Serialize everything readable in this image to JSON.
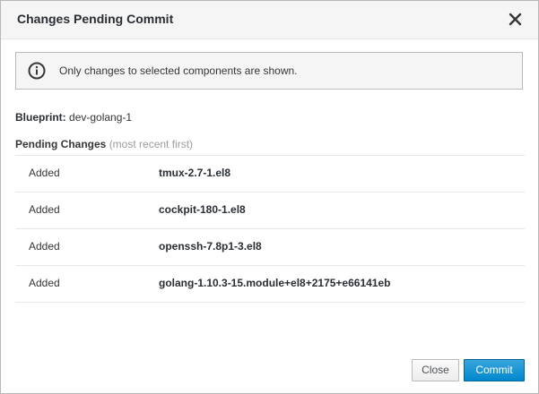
{
  "dialog": {
    "title": "Changes Pending Commit",
    "close_icon": "close-icon"
  },
  "alert": {
    "icon": "info-icon",
    "text": "Only changes to selected components are shown."
  },
  "blueprint": {
    "label": "Blueprint:",
    "value": "dev-golang-1"
  },
  "pending": {
    "title": "Pending Changes",
    "subtitle": "(most recent first)",
    "changes": [
      {
        "action": "Added",
        "package": "tmux-2.7-1.el8"
      },
      {
        "action": "Added",
        "package": "cockpit-180-1.el8"
      },
      {
        "action": "Added",
        "package": "openssh-7.8p1-3.el8"
      },
      {
        "action": "Added",
        "package": "golang-1.10.3-15.module+el8+2175+e66141eb"
      }
    ]
  },
  "footer": {
    "close_label": "Close",
    "commit_label": "Commit"
  },
  "colors": {
    "primary": "#0088ce",
    "header_bg": "#f5f5f5",
    "border": "#bbbbbb"
  }
}
